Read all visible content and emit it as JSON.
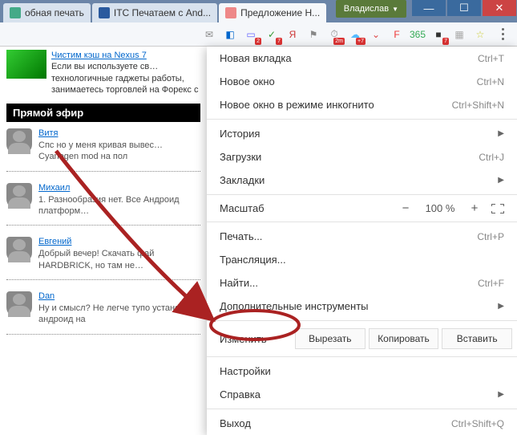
{
  "window": {
    "user": "Владислав",
    "tabs": [
      {
        "title": "обная печать"
      },
      {
        "title": "ITC Печатаем с And..."
      },
      {
        "title": "Предложение Н..."
      }
    ]
  },
  "toolbar_icons": [
    {
      "name": "mail-icon",
      "glyph": "✉",
      "color": "#888"
    },
    {
      "name": "cube-icon",
      "glyph": "◧",
      "color": "#06c"
    },
    {
      "name": "docs-icon",
      "glyph": "▭",
      "color": "#66f",
      "badge": "2"
    },
    {
      "name": "check-icon",
      "glyph": "✓",
      "color": "#393",
      "badge": "7"
    },
    {
      "name": "yandex-icon",
      "glyph": "Я",
      "color": "#c33"
    },
    {
      "name": "flag-icon",
      "glyph": "⚑",
      "color": "#888"
    },
    {
      "name": "timer-icon",
      "glyph": "⏱",
      "color": "#888",
      "badge": "2m"
    },
    {
      "name": "cloud-icon",
      "glyph": "☁",
      "color": "#5bf",
      "badge": "+7"
    },
    {
      "name": "pocket-icon",
      "glyph": "⌄",
      "color": "#d44"
    },
    {
      "name": "flip-icon",
      "glyph": "F",
      "color": "#e33"
    },
    {
      "name": "cal-icon",
      "glyph": "365",
      "color": "#3a5"
    },
    {
      "name": "note-icon",
      "glyph": "■",
      "color": "#333",
      "badge": "7"
    },
    {
      "name": "ext-icon",
      "glyph": "▦",
      "color": "#aaa"
    },
    {
      "name": "star-icon",
      "glyph": "☆",
      "color": "#cc3"
    }
  ],
  "content": {
    "news_link": "Чистим кэш на Nexus 7",
    "news_body": "Если вы используете св… технологичные гаджеты работы, занимаетесь торговлей на Форекс с",
    "section": "Прямой эфир",
    "comments": [
      {
        "user": "Витя",
        "text": "Спс но у меня кривая вывес… Cyanogen mod на пол"
      },
      {
        "user": "Михаил",
        "text": "1. Разнообразия нет. Все Андроид платформ…"
      },
      {
        "user": "Евгений",
        "text": "Добрый вечер! Скачать фай HARDBRICK, но там не…"
      },
      {
        "user": "Dan",
        "text": "Ну и смысл? Не легче тупо установить андроид на"
      }
    ]
  },
  "menu": {
    "new_tab": {
      "label": "Новая вкладка",
      "shortcut": "Ctrl+T"
    },
    "new_window": {
      "label": "Новое окно",
      "shortcut": "Ctrl+N"
    },
    "incognito": {
      "label": "Новое окно в режиме инкогнито",
      "shortcut": "Ctrl+Shift+N"
    },
    "history": {
      "label": "История"
    },
    "downloads": {
      "label": "Загрузки",
      "shortcut": "Ctrl+J"
    },
    "bookmarks": {
      "label": "Закладки"
    },
    "zoom": {
      "label": "Масштаб",
      "value": "100 %"
    },
    "print": {
      "label": "Печать...",
      "shortcut": "Ctrl+P"
    },
    "cast": {
      "label": "Трансляция..."
    },
    "find": {
      "label": "Найти...",
      "shortcut": "Ctrl+F"
    },
    "tools": {
      "label": "Дополнительные инструменты"
    },
    "edit": {
      "label": "Изменить",
      "cut": "Вырезать",
      "copy": "Копировать",
      "paste": "Вставить"
    },
    "settings": {
      "label": "Настройки"
    },
    "help": {
      "label": "Справка"
    },
    "exit": {
      "label": "Выход",
      "shortcut": "Ctrl+Shift+Q"
    }
  }
}
